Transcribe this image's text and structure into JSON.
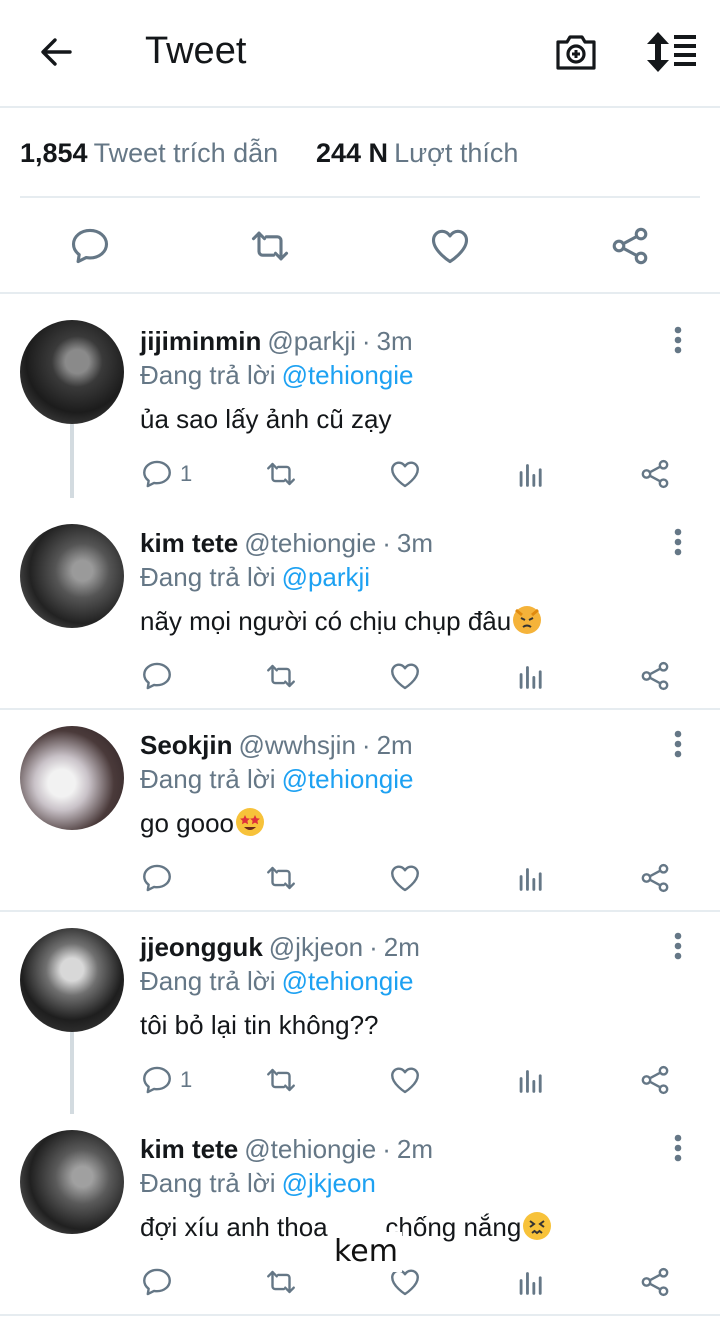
{
  "header": {
    "title": "Tweet"
  },
  "stats": {
    "quotes_count": "1,854",
    "quotes_label": "Tweet trích dẫn",
    "likes_count": "244 N",
    "likes_label": "Lượt thích"
  },
  "replies": [
    {
      "name": "jijiminmin",
      "handle": "@parkji",
      "time": "3m",
      "replying_label": "Đang trả lời",
      "replying_to": "@tehiongie",
      "text": "ủa sao lấy ảnh cũ zạy",
      "reply_count": "1"
    },
    {
      "name": "kim tete",
      "handle": "@tehiongie",
      "time": "3m",
      "replying_label": "Đang trả lời",
      "replying_to": "@parkji",
      "text": "nãy mọi người có chịu chụp đâu",
      "reply_count": ""
    },
    {
      "name": "Seokjin",
      "handle": "@wwhsjin",
      "time": "2m",
      "replying_label": "Đang trả lời",
      "replying_to": "@tehiongie",
      "text": "go gooo",
      "reply_count": ""
    },
    {
      "name": "jjeongguk",
      "handle": "@jkjeon",
      "time": "2m",
      "replying_label": "Đang trả lời",
      "replying_to": "@tehiongie",
      "text": "tôi bỏ lại tin không??",
      "reply_count": "1"
    },
    {
      "name": "kim tete",
      "handle": "@tehiongie",
      "time": "2m",
      "replying_label": "Đang trả lời",
      "replying_to": "@jkjeon",
      "text": "đợi xíu anh thoa        chống nắng",
      "reply_count": ""
    }
  ],
  "sticker_text": "kem",
  "icons": [
    "back-arrow-icon",
    "camera-plus-icon",
    "sort-icon",
    "reply-icon",
    "retweet-icon",
    "like-icon",
    "share-icon",
    "analytics-icon",
    "more-vertical-icon"
  ],
  "colors": {
    "accent": "#1da1f2",
    "muted": "#657786",
    "divider": "#e6ecf0"
  }
}
